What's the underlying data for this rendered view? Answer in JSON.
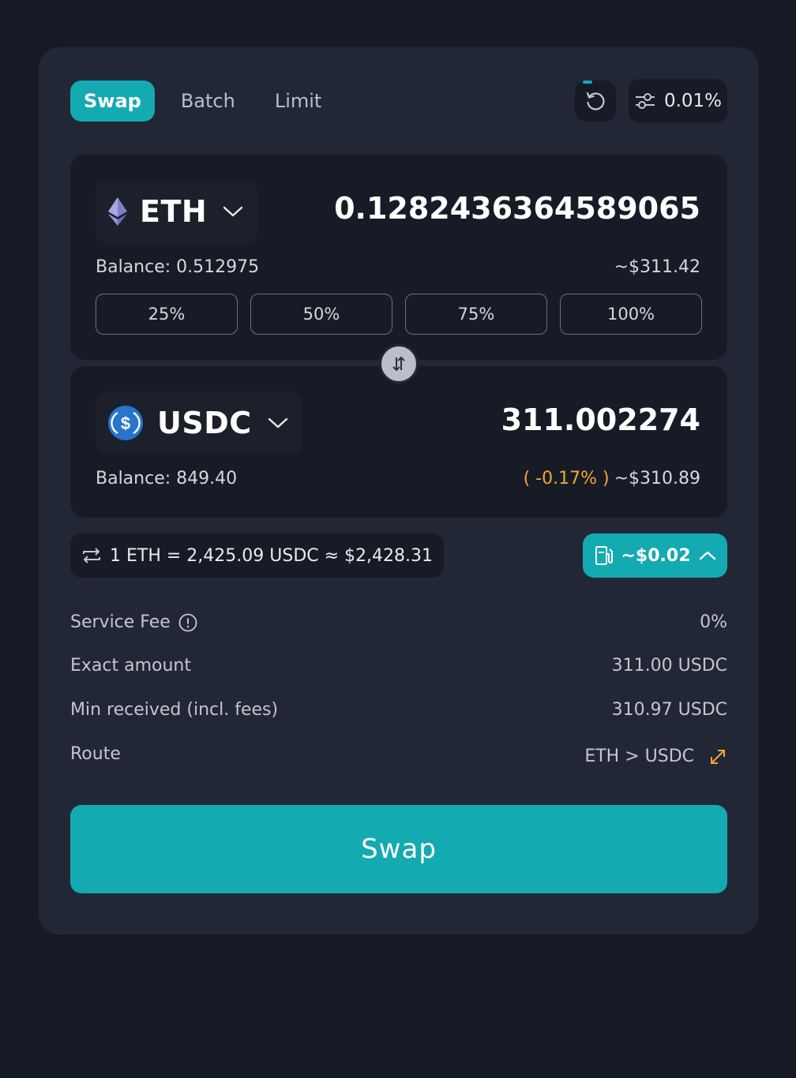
{
  "tabs": [
    {
      "label": "Swap",
      "active": true
    },
    {
      "label": "Batch",
      "active": false
    },
    {
      "label": "Limit",
      "active": false
    }
  ],
  "header": {
    "refresh_icon": "refresh-icon",
    "slippage_icon": "sliders-icon",
    "slippage": "0.01%"
  },
  "from": {
    "token": "ETH",
    "token_icon": "eth-logo-icon",
    "amount": "0.1282436364589065",
    "balance": "Balance: 0.512975",
    "usd": "~$311.42",
    "pct_buttons": [
      "25%",
      "50%",
      "75%",
      "100%"
    ]
  },
  "to": {
    "token": "USDC",
    "token_icon": "usdc-logo-icon",
    "amount": "311.002274",
    "balance": "Balance: 849.40",
    "price_impact": "( -0.17% )",
    "usd": "~$310.89"
  },
  "rate": "1 ETH = 2,425.09 USDC ≈ $2,428.31",
  "gas": {
    "label": "~$0.02",
    "icon": "gas-pump-icon"
  },
  "details": {
    "service_fee": {
      "label": "Service Fee",
      "value": "0%"
    },
    "exact_amount": {
      "label": "Exact amount",
      "value": "311.00 USDC"
    },
    "min_received": {
      "label": "Min received (incl. fees)",
      "value": "310.97 USDC"
    },
    "route": {
      "label": "Route",
      "value": "ETH > USDC"
    }
  },
  "swap_button": "Swap",
  "colors": {
    "accent": "#14aab2",
    "background": "#161a25",
    "card": "#212735",
    "panel": "#161b26",
    "warning": "#f3a730"
  }
}
